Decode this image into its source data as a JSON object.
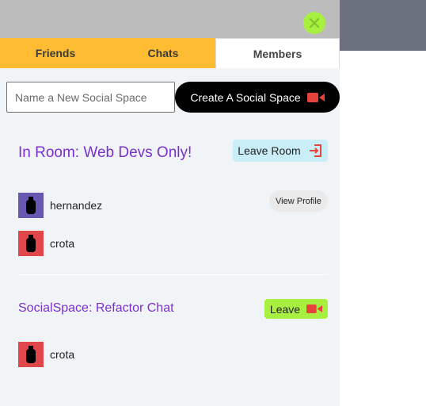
{
  "tabs": [
    {
      "label": "Friends",
      "active": false
    },
    {
      "label": "Chats",
      "active": false
    },
    {
      "label": "Members",
      "active": true
    }
  ],
  "new_space": {
    "placeholder": "Name a New Social Space",
    "value": "",
    "create_label": "Create A Social Space"
  },
  "current_room": {
    "title": "In Room: Web Devs Only!",
    "leave_label": "Leave Room",
    "members": [
      {
        "name": "hernandez",
        "avatar_color": "#6757b0"
      },
      {
        "name": "crota",
        "avatar_color": "#e0474a"
      }
    ],
    "view_profile_label": "View Profile"
  },
  "social_space": {
    "title": "SocialSpace: Refactor Chat",
    "leave_label": "Leave",
    "members": [
      {
        "name": "crota",
        "avatar_color": "#e0474a"
      }
    ]
  },
  "colors": {
    "tab_inactive": "#fdbc32",
    "accent_purple": "#7a2fd0",
    "lime": "#a8f040",
    "leave_room_bg": "#c9eef8",
    "icon_red": "#e8433a"
  },
  "icons": {
    "close": "close-icon",
    "video": "video-camera-icon",
    "exit": "exit-icon",
    "user": "user-silhouette-icon"
  }
}
